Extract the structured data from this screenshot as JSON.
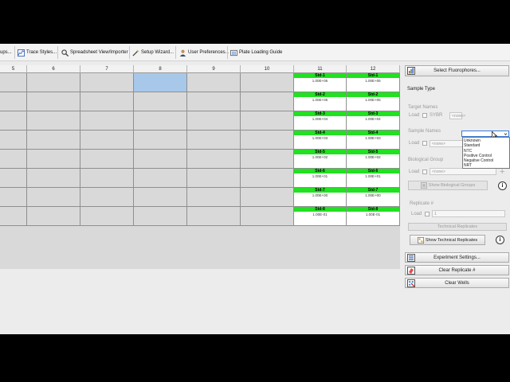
{
  "toolbar": {
    "items": [
      {
        "label": "ups..."
      },
      {
        "label": "Trace Styles..."
      },
      {
        "label": "Spreadsheet View/Importer"
      },
      {
        "label": "Setup Wizard..."
      },
      {
        "label": "User Preferences..."
      },
      {
        "label": "Plate Loading Guide"
      }
    ]
  },
  "grid": {
    "columns": [
      "5",
      "6",
      "7",
      "8",
      "9",
      "10",
      "11",
      "12"
    ],
    "standards": [
      {
        "label": "Std-1",
        "value": "1.00E+06"
      },
      {
        "label": "Std-2",
        "value": "1.00E+05"
      },
      {
        "label": "Std-3",
        "value": "1.00E+04"
      },
      {
        "label": "Std-4",
        "value": "1.00E+03"
      },
      {
        "label": "Std-5",
        "value": "1.00E+02"
      },
      {
        "label": "Std-6",
        "value": "1.00E+01"
      },
      {
        "label": "Std-7",
        "value": "1.00E+00"
      },
      {
        "label": "Std-8",
        "value": "1.00E-01"
      }
    ]
  },
  "panel": {
    "select_fluorophores": "Select Fluorophores...",
    "sample_type_label": "Sample Type",
    "sample_type_options": [
      "Unknown",
      "Standard",
      "NTC",
      "Positive Control",
      "Negative Control",
      "NRT"
    ],
    "target_names_label": "Target Names",
    "load_label": "Load",
    "sybr_label": "SYBR",
    "target_combo_value": "<none>",
    "sample_names_label": "Sample Names",
    "sample_combo_value": "<none>",
    "biological_group_label": "Biological Group",
    "bio_combo_value": "<none>",
    "show_bio_groups": "Show Biological Groups",
    "replicate_label": "Replicate #",
    "replicate_value": "1",
    "technical_replicates": "Technical Replicates",
    "show_tech_replicates": "Show Technical Replicates",
    "experiment_settings": "Experiment Settings...",
    "clear_replicate": "Clear Replicate #",
    "clear_wells": "Clear Wells",
    "info_glyph": "i"
  }
}
